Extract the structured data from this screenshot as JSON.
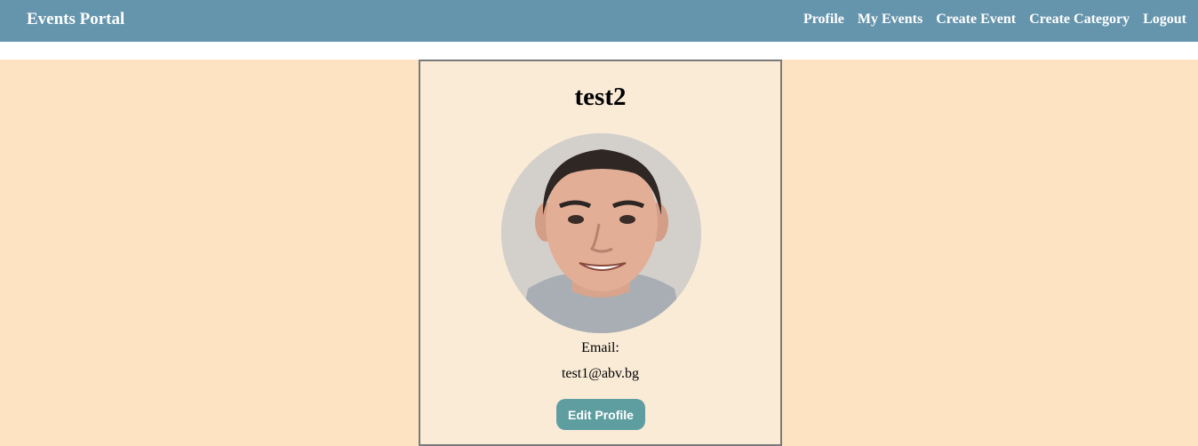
{
  "navbar": {
    "brand": "Events Portal",
    "links": [
      "Profile",
      "My Events",
      "Create Event",
      "Create Category",
      "Logout"
    ]
  },
  "profile": {
    "username": "test2",
    "avatar": "profile-photo",
    "email_label": "Email:",
    "email": "test1@abv.bg",
    "edit_button": "Edit Profile"
  },
  "colors": {
    "navbar_bg": "#6595ad",
    "page_bg": "#fde3c2",
    "card_bg": "#faebd7",
    "button_bg": "#5f9ea0"
  }
}
